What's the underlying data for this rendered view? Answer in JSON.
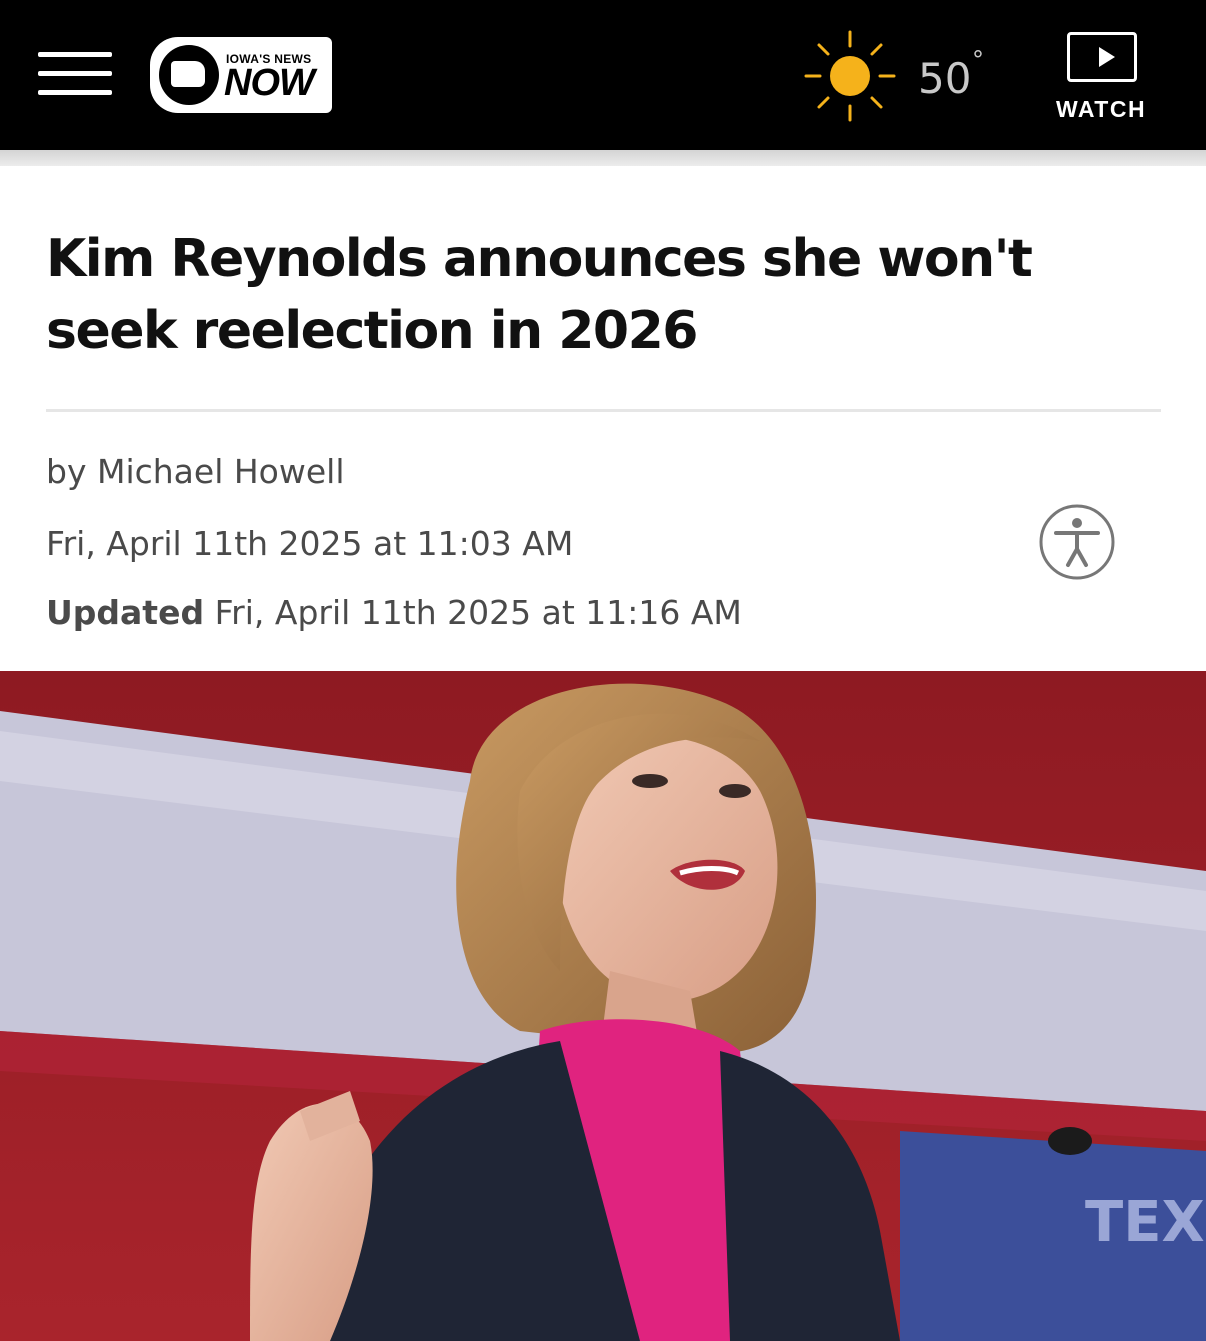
{
  "header": {
    "menu_icon": "hamburger-menu-icon",
    "logo": {
      "tagline": "IOWA'S NEWS",
      "wordmark": "NOW"
    },
    "weather": {
      "icon": "sun-icon",
      "temperature": "50",
      "degree_symbol": "°"
    },
    "watch": {
      "icon": "play-icon",
      "label": "WATCH"
    }
  },
  "article": {
    "headline": "Kim Reynolds announces she won't seek reelection in 2026",
    "byline": "by Michael Howell",
    "published": "Fri, April 11th 2025 at 11:03 AM",
    "updated_label": "Updated",
    "updated_time": "Fri, April 11th 2025 at 11:16 AM",
    "accessibility_icon": "accessibility-icon",
    "hero_sign_text": "TEX"
  },
  "colors": {
    "header_bg": "#000000",
    "sun": "#f5b21b",
    "headline": "#111111",
    "meta_text": "#4a4a4a"
  }
}
